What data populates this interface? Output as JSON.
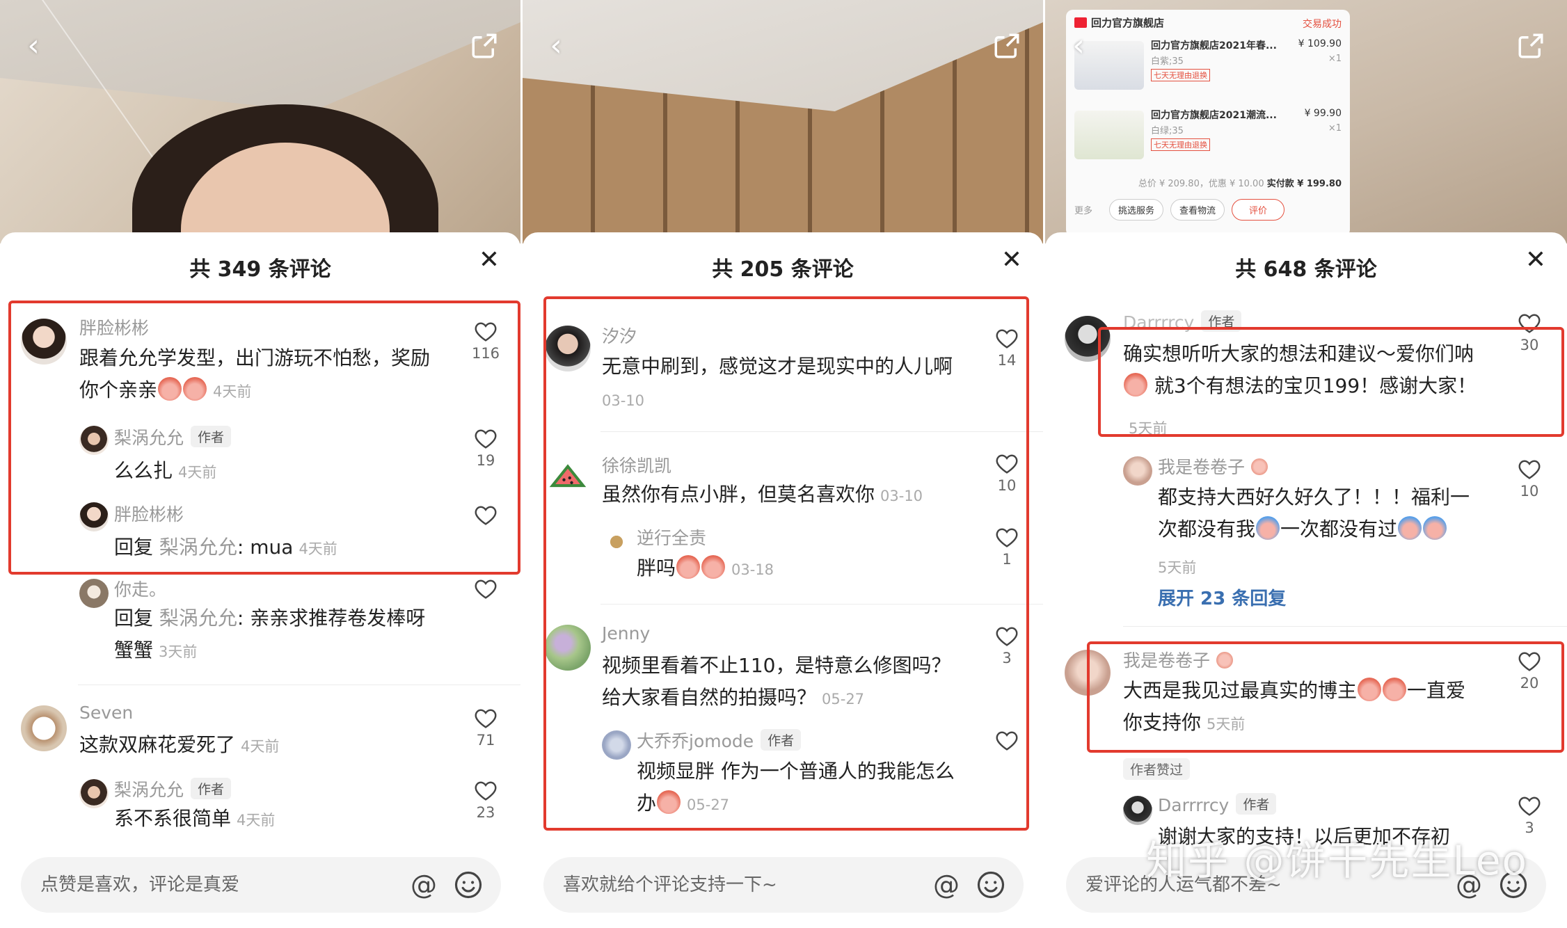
{
  "watermark": "知乎 @饼干先生Leo",
  "panels": [
    {
      "title": "共 349 条评论",
      "input_placeholder": "点赞是喜欢，评论是真爱",
      "comments": [
        {
          "name": "胖脸彬彬",
          "line1": "跟着允允学发型，出门游玩不怕愁，奖励",
          "line2": "你个亲亲",
          "time": "4天前",
          "likes": "116"
        },
        {
          "name": "梨涡允允",
          "badge": "作者",
          "text": "么么扎",
          "time": "4天前",
          "likes": "19"
        },
        {
          "name": "胖脸彬彬",
          "reply_prefix": "回复 ",
          "reply_to": "梨涡允允",
          "text": ": mua",
          "time": "4天前"
        },
        {
          "name": "你走。",
          "reply_prefix": "回复 ",
          "reply_to": "梨涡允允",
          "text": ": 亲亲求推荐卷发棒呀",
          "line2": "蟹蟹",
          "time": "3天前"
        },
        {
          "name": "Seven",
          "text": "这款双麻花爱死了",
          "time": "4天前",
          "likes": "71"
        },
        {
          "name": "梨涡允允",
          "badge": "作者",
          "text": "系不系很简单",
          "time": "4天前",
          "likes": "23"
        }
      ]
    },
    {
      "title": "共 205 条评论",
      "input_placeholder": "喜欢就给个评论支持一下~",
      "comments": [
        {
          "name": "汐汐",
          "text": "无意中刷到，感觉这才是现实中的人儿啊",
          "time": "03-10",
          "likes": "14"
        },
        {
          "name": "徐徐凯凯",
          "text": "虽然你有点小胖，但莫名喜欢你",
          "time": "03-10",
          "likes": "10"
        },
        {
          "name": "逆行全责",
          "text": "胖吗",
          "time": "03-18",
          "likes": "1"
        },
        {
          "name": "Jenny",
          "line1": "视频里看着不止110，是特意么修图吗？",
          "line2": "给大家看自然的拍摄吗？",
          "time": "05-27",
          "likes": "3"
        },
        {
          "name": "大乔乔jomode",
          "badge": "作者",
          "line1": "视频显胖 作为一个普通人的我能怎么",
          "line2": "办",
          "time": "05-27"
        }
      ]
    },
    {
      "title": "共 648 条评论",
      "input_placeholder": "爱评论的人运气都不差~",
      "order": {
        "store": "回力官方旗舰店",
        "status": "交易成功",
        "items": [
          {
            "title": "回力官方旗舰店2021年春...",
            "price": "¥ 109.90",
            "spec": "白紫;35",
            "qty": "×1",
            "tag": "七天无理由退换"
          },
          {
            "title": "回力官方旗舰店2021潮流...",
            "price": "¥ 99.90",
            "spec": "白绿;35",
            "qty": "×1",
            "tag": "七天无理由退换"
          }
        ],
        "total": "总价 ¥ 209.80，优惠 ¥ 10.00",
        "paid": "实付款 ¥ 199.80",
        "more": "更多",
        "btn1": "挑选服务",
        "btn2": "查看物流",
        "btn3": "评价"
      },
      "comments": [
        {
          "name": "Darrrrcy",
          "badge": "作者",
          "line1": "确实想听听大家的想法和建议～爱你们呐",
          "line2": "就3个有想法的宝贝199！感谢大家！",
          "time": "5天前",
          "likes": "30"
        },
        {
          "name": "我是卷卷子",
          "line1": "都支持大西好久好久了！！！福利一",
          "line2": "次都没有我",
          "mid": "一次都没有过",
          "time": "5天前",
          "likes": "10"
        },
        {
          "expand": "展开 23 条回复"
        },
        {
          "name": "我是卷卷子",
          "line1": "大西是我见过最真实的博主",
          "line1b": "一直爱",
          "line2": "你支持你",
          "time": "5天前",
          "likes": "20",
          "liked_tag": "作者赞过"
        },
        {
          "name": "Darrrrcy",
          "badge": "作者",
          "text": "谢谢大家的支持！以后更加不存初",
          "likes": "3"
        }
      ]
    }
  ]
}
